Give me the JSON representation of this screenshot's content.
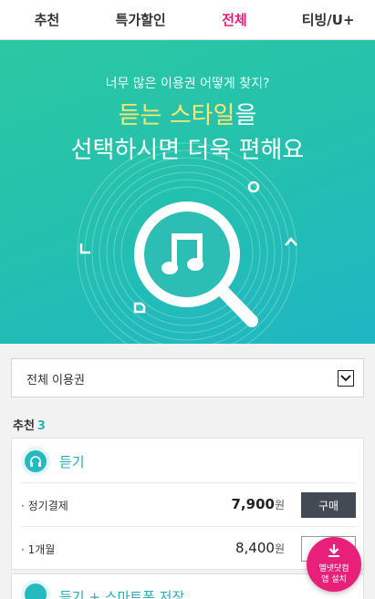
{
  "tabs": [
    {
      "label": "추천"
    },
    {
      "label": "특가할인"
    },
    {
      "label": "전체",
      "active": true
    },
    {
      "label": "티빙/U+"
    }
  ],
  "hero": {
    "subtitle": "너무 많은 이용권 어떻게 찾지?",
    "headline_highlight": "듣는 스타일",
    "headline_rest": "을",
    "headline_line2": "선택하시면 더욱 편해요",
    "icon": "music-note-magnifier",
    "colors": {
      "gradient_start": "#2cc8a3",
      "gradient_end": "#20b6c4",
      "highlight": "#ffe66e"
    }
  },
  "filter": {
    "selected": "전체 이용권",
    "icon": "chevron-down-icon"
  },
  "section": {
    "title": "추천",
    "count": "3"
  },
  "card": {
    "icon": "headphones-icon",
    "title": "듣기",
    "rows": [
      {
        "name": "· 정기결제",
        "price": "7,900",
        "unit": "원",
        "button": "구매"
      },
      {
        "name": "· 1개월",
        "price": "8,400",
        "unit": "원",
        "button": ""
      }
    ]
  },
  "card2": {
    "icon": "phone-download-icon",
    "title": "듣기 + 스마트폰 저장"
  },
  "fab": {
    "icon": "download-icon",
    "line1": "멜넷닷컴",
    "line2": "앱 설치",
    "color": "#e8207a"
  }
}
